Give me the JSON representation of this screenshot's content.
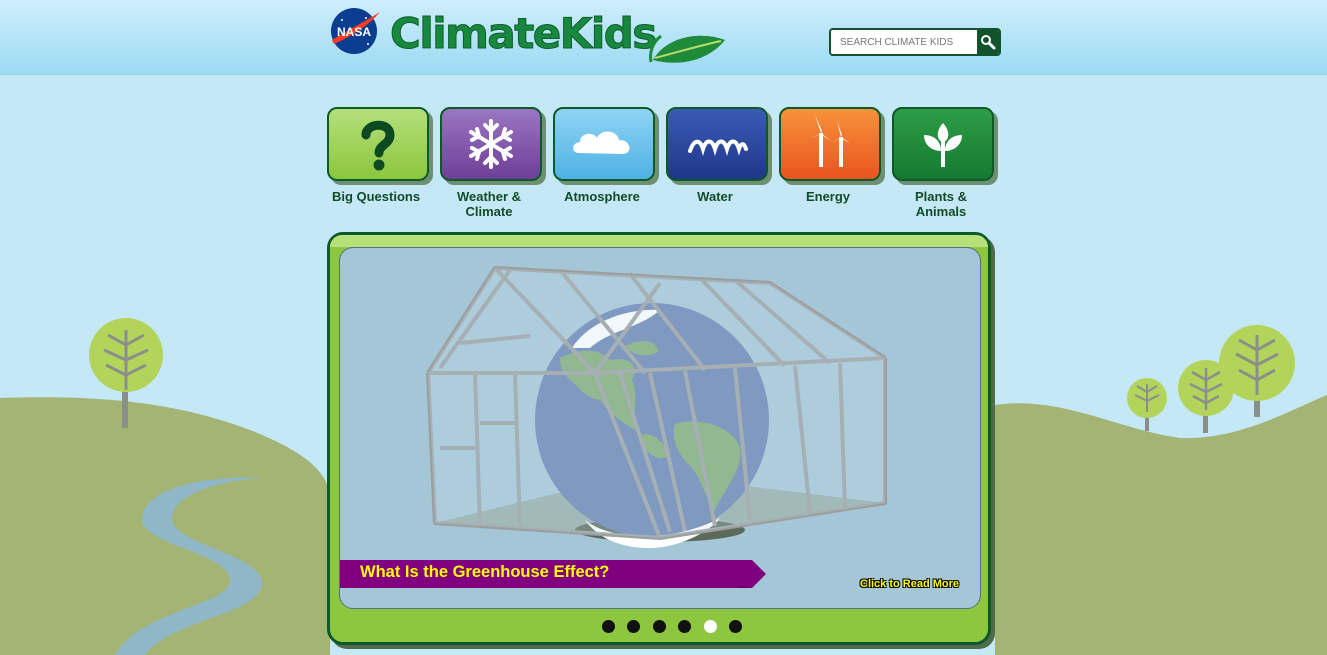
{
  "header": {
    "logo_text": "NASA",
    "brand": "ClimateKids",
    "search": {
      "placeholder": "SEARCH CLIMATE KIDS",
      "value": ""
    }
  },
  "categories": [
    {
      "label": "Big Questions",
      "icon": "question-mark-icon",
      "color": "#8cc63f"
    },
    {
      "label": "Weather & Climate",
      "icon": "snowflake-icon",
      "color": "#7a4ea3"
    },
    {
      "label": "Atmosphere",
      "icon": "cloud-icon",
      "color": "#69c0ec"
    },
    {
      "label": "Water",
      "icon": "waves-icon",
      "color": "#27439a"
    },
    {
      "label": "Energy",
      "icon": "wind-turbines-icon",
      "color": "#f26a24"
    },
    {
      "label": "Plants & Animals",
      "icon": "sprout-icon",
      "color": "#1e8a3a"
    }
  ],
  "slideshow": {
    "title": "What Is the Greenhouse Effect?",
    "read_more": "Click to Read More",
    "total_slides": 6,
    "active_slide": 5
  },
  "colors": {
    "banner": "#800080",
    "banner_text": "#ffff00",
    "frame": "#8dc63f",
    "sky": "#c5e8f6",
    "hills": "#a3b474"
  }
}
